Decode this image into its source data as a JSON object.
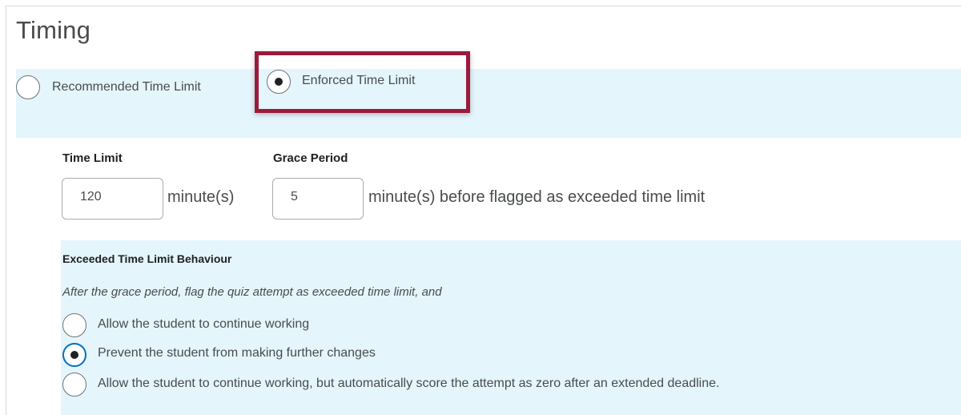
{
  "heading": "Timing",
  "time_limit_type": {
    "options": [
      {
        "label": "Recommended Time Limit",
        "selected": false
      },
      {
        "label": "Enforced Time Limit",
        "selected": true
      }
    ]
  },
  "time_limit": {
    "label": "Time Limit",
    "value": "120",
    "unit": "minute(s)"
  },
  "grace_period": {
    "label": "Grace Period",
    "value": "5",
    "unit": "minute(s) before flagged as exceeded time limit"
  },
  "exceeded_behaviour": {
    "title": "Exceeded Time Limit Behaviour",
    "description": "After the grace period, flag the quiz attempt as exceeded time limit, and",
    "options": [
      {
        "label": "Allow the student to continue working",
        "selected": false
      },
      {
        "label": "Prevent the student from making further changes",
        "selected": true
      },
      {
        "label": "Allow the student to continue working, but automatically score the attempt as zero after an extended deadline.",
        "selected": false
      }
    ]
  },
  "colors": {
    "highlight_border": "#9b1b3b",
    "section_background": "#e4f5fc",
    "focus_ring": "#006fbf"
  }
}
